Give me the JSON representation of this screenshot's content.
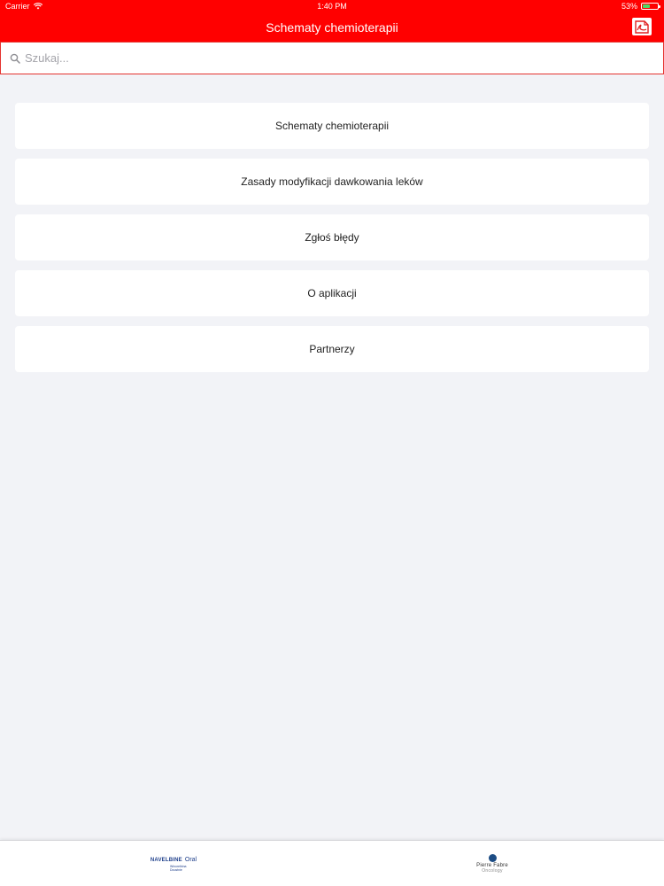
{
  "status_bar": {
    "carrier": "Carrier",
    "time": "1:40 PM",
    "battery": "53%",
    "battery_level": 0.53
  },
  "nav": {
    "title": "Schematy chemioterapii",
    "action_icon": "pdf-icon"
  },
  "search": {
    "placeholder": "Szukaj..."
  },
  "menu": {
    "items": [
      {
        "label": "Schematy chemioterapii"
      },
      {
        "label": "Zasady modyfikacji dawkowania leków"
      },
      {
        "label": "Zgłoś błędy"
      },
      {
        "label": "O aplikacji"
      },
      {
        "label": "Partnerzy"
      }
    ]
  },
  "bottom_bar": {
    "partners": [
      {
        "name": "NAVELBINE",
        "suffix": "Oral",
        "sub": "Winorelbina Doustnie"
      },
      {
        "name": "Pierre Fabre",
        "sub": "Oncology"
      }
    ]
  },
  "colors": {
    "brand": "#ff0000",
    "background": "#f2f3f7",
    "card": "#ffffff",
    "search_border": "#e4332f"
  }
}
